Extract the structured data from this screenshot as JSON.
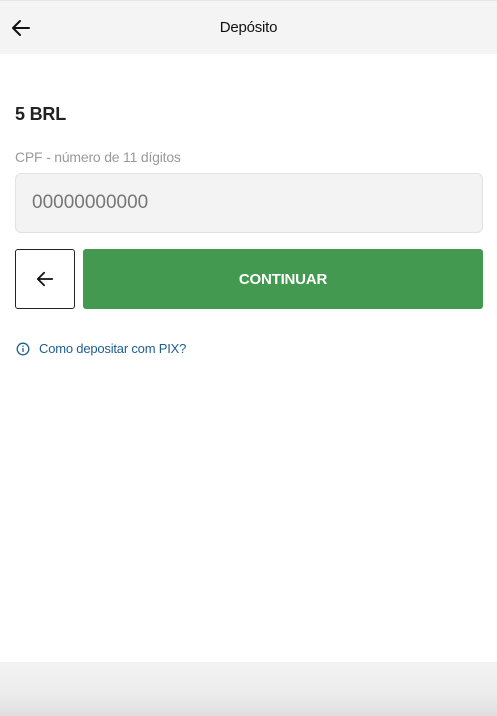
{
  "header": {
    "title": "Depósito",
    "back_icon": "arrow-left-icon"
  },
  "form": {
    "amount": "5 BRL",
    "cpf_label": "CPF - número de 11 dígitos",
    "cpf_placeholder": "00000000000"
  },
  "actions": {
    "back_icon": "arrow-left-icon",
    "continue_label": "CONTINUAR"
  },
  "help": {
    "icon": "info-icon",
    "label": "Como depositar com PIX?"
  },
  "colors": {
    "primary": "#43994f",
    "link": "#1d5f8f",
    "header_bg": "#f4f4f4"
  }
}
